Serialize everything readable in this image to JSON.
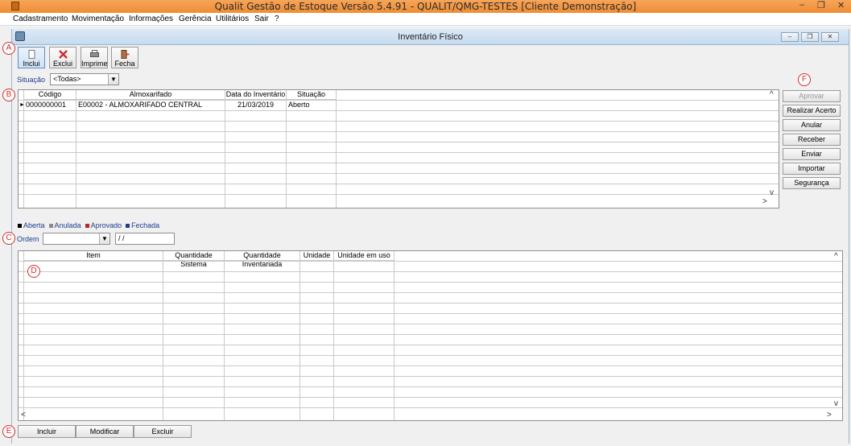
{
  "window": {
    "title": "Qualit Gestão de Estoque Versão 5.4.91 - QUALIT/QMG-TESTES [Cliente Demonstração]"
  },
  "menu": [
    "Cadastramento",
    "Movimentação",
    "Informações",
    "Gerência",
    "Utilitários",
    "Sair",
    "?"
  ],
  "child": {
    "title": "Inventário Físico"
  },
  "toolbar": {
    "incluir": "Inclui",
    "excluir": "Exclui",
    "imprime": "Imprime",
    "fecha": "Fecha"
  },
  "filter": {
    "label": "Situação",
    "value": "<Todas>"
  },
  "grid1": {
    "headers": [
      "Código",
      "Almoxarifado",
      "Data do Inventário",
      "Situação"
    ],
    "rows": [
      [
        "0000000001",
        "E00002 - ALMOXARIFADO CENTRAL",
        "21/03/2019",
        "Aberto"
      ]
    ]
  },
  "legend": [
    {
      "label": "Aberta",
      "color": "#000000"
    },
    {
      "label": "Anulada",
      "color": "#8a8a8a"
    },
    {
      "label": "Aprovado",
      "color": "#b22a2a"
    },
    {
      "label": "Fechada",
      "color": "#1c3f8e"
    }
  ],
  "ordem": {
    "label": "Ordem",
    "value": "",
    "date": " /  /"
  },
  "grid2": {
    "headers": [
      "Item",
      "Quantidade Sistema",
      "Quantidade Inventariada",
      "Unidade",
      "Unidade em uso"
    ]
  },
  "side_buttons": [
    "Aprovar",
    "Realizar Acerto",
    "Anular",
    "Receber",
    "Enviar",
    "Importar",
    "Segurança"
  ],
  "bottom_buttons": [
    "Incluir",
    "Modificar",
    "Excluir"
  ],
  "markers": [
    "A",
    "B",
    "C",
    "D",
    "E",
    "F"
  ],
  "scroll": {
    "up": "^",
    "down": "v",
    "left": "<",
    "right": ">"
  },
  "window_controls": {
    "minimize": "–",
    "restore": "❐",
    "close": "✕",
    "child_minimize": "–",
    "child_restore": "❐",
    "child_close": "✕"
  },
  "colors": {
    "title_bar": "#ef8d32",
    "child_title": "#c7dbef",
    "accent_blue": "#1c3f8e",
    "marker_red": "#d32c2c"
  }
}
